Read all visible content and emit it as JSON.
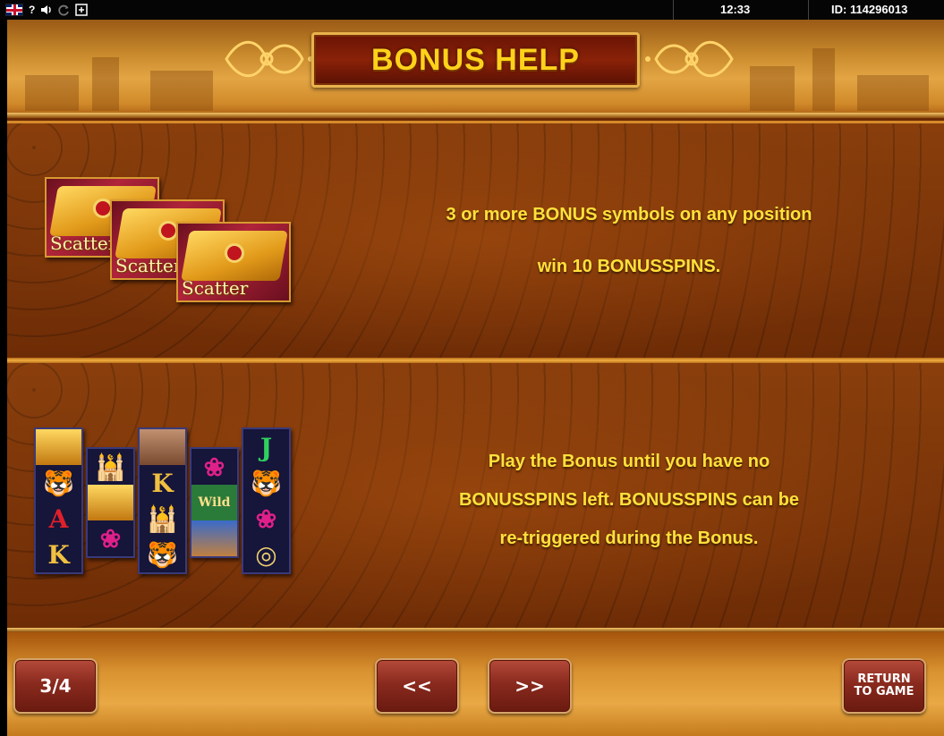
{
  "status_bar": {
    "icons": [
      "uk-flag-icon",
      "help-icon",
      "sound-icon",
      "reload-icon",
      "fullscreen-icon"
    ],
    "help_glyph": "?",
    "time": "12:33",
    "game_id": "ID: 114296013"
  },
  "header": {
    "title": "BONUS HELP"
  },
  "panels": {
    "bonus": {
      "line1": "3 or more BONUS symbols on any position",
      "line2": "win 10 BONUSSPINS.",
      "scatter_label": "Scatter"
    },
    "play": {
      "line1": "Play the Bonus until you have no",
      "line2": "BONUSSPINS left. BONUSSPINS can be",
      "line3": "re-triggered during the Bonus.",
      "wild_label": "Wild"
    }
  },
  "footer": {
    "page_indicator": "3/4",
    "prev_label": "<<",
    "next_label": ">>",
    "return_line1": "RETURN",
    "return_line2": "TO GAME"
  },
  "colors": {
    "title_text": "#ffd21a",
    "panel_text": "#ffe13a",
    "panel_bg": "#7a3208",
    "button_bg": "#8a2a1e"
  }
}
